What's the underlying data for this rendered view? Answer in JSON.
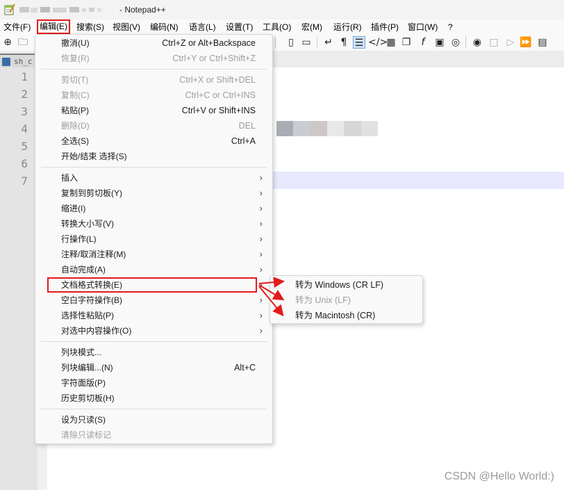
{
  "window": {
    "title": "- Notepad++"
  },
  "menubar": {
    "items": [
      "文件(F)",
      "编辑(E)",
      "搜索(S)",
      "视图(V)",
      "编码(N)",
      "语言(L)",
      "设置(T)",
      "工具(O)",
      "宏(M)",
      "运行(R)",
      "插件(P)",
      "窗口(W)",
      "?"
    ]
  },
  "tab": {
    "label": "sh_c"
  },
  "editor": {
    "line_numbers": [
      "1",
      "2",
      "3",
      "4",
      "5",
      "6",
      "7"
    ]
  },
  "edit_menu": {
    "undo": {
      "label": "撤消(U)",
      "shortcut": "Ctrl+Z or Alt+Backspace"
    },
    "redo": {
      "label": "恢复(R)",
      "shortcut": "Ctrl+Y or Ctrl+Shift+Z"
    },
    "cut": {
      "label": "剪切(T)",
      "shortcut": "Ctrl+X or Shift+DEL"
    },
    "copy": {
      "label": "复制(C)",
      "shortcut": "Ctrl+C or Ctrl+INS"
    },
    "paste": {
      "label": "粘贴(P)",
      "shortcut": "Ctrl+V or Shift+INS"
    },
    "delete": {
      "label": "删除(D)",
      "shortcut": "DEL"
    },
    "select_all": {
      "label": "全选(S)",
      "shortcut": "Ctrl+A"
    },
    "begin_end_select": {
      "label": "开始/结束 选择(S)"
    },
    "insert": {
      "label": "插入"
    },
    "copy_to_clipboard": {
      "label": "复制到剪切板(Y)"
    },
    "indent": {
      "label": "缩进(I)"
    },
    "convert_case": {
      "label": "转换大小写(V)"
    },
    "line_ops": {
      "label": "行操作(L)"
    },
    "comment": {
      "label": "注释/取消注释(M)"
    },
    "auto_complete": {
      "label": "自动完成(A)"
    },
    "eol_conversion": {
      "label": "文档格式转换(E)"
    },
    "blank_ops": {
      "label": "空白字符操作(B)"
    },
    "paste_special": {
      "label": "选择性粘贴(P)"
    },
    "on_selection": {
      "label": "对选中内容操作(O)"
    },
    "column_mode": {
      "label": "列块模式..."
    },
    "column_editor": {
      "label": "列块编辑...(N)",
      "shortcut": "Alt+C"
    },
    "char_panel": {
      "label": "字符面版(P)"
    },
    "clipboard_history": {
      "label": "历史剪切板(H)"
    },
    "set_readonly": {
      "label": "设为只读(S)"
    },
    "clear_readonly": {
      "label": "清除只读标记"
    }
  },
  "eol_submenu": {
    "windows": "转为 Windows (CR LF)",
    "unix": "转为 Unix (LF)",
    "mac": "转为 Macintosh (CR)"
  },
  "colors": {
    "annotation": "#e31b1b",
    "current_line": "#e8e8ff"
  },
  "watermark": "CSDN @Hello World:)"
}
